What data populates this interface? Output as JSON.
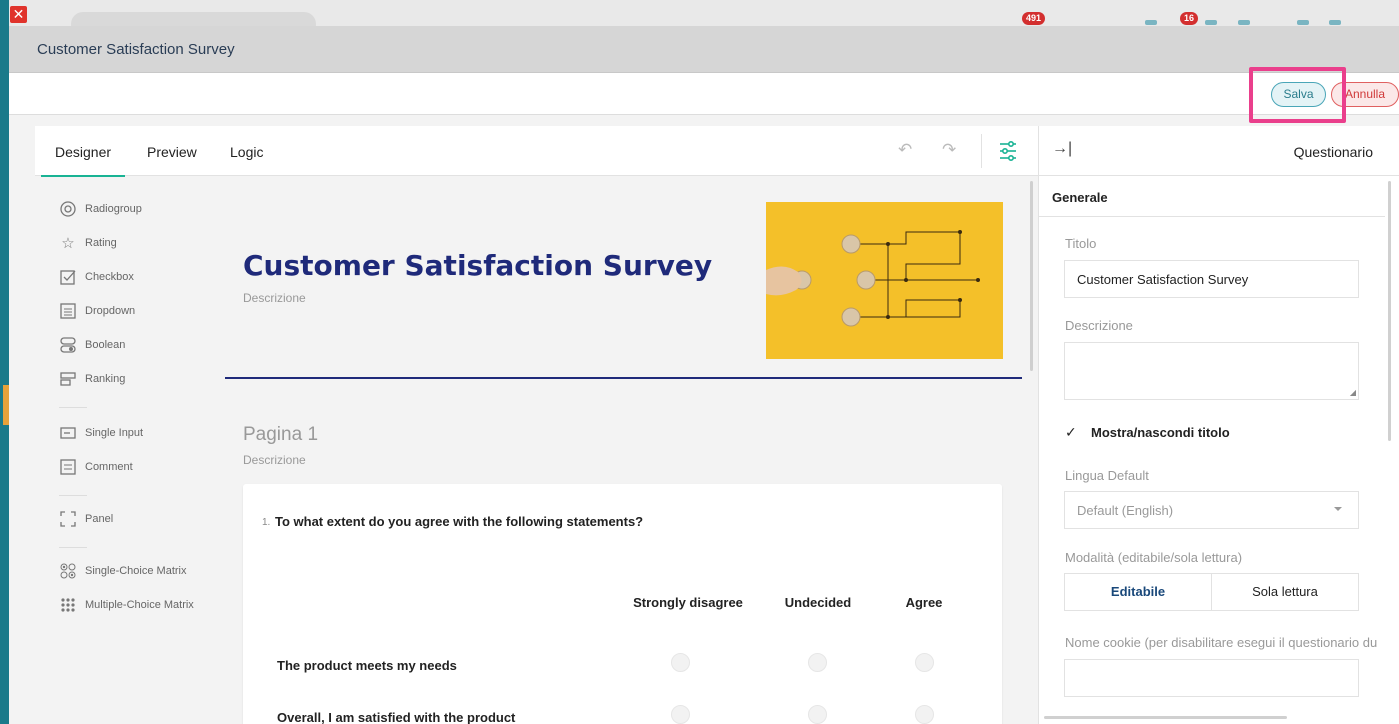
{
  "app": {
    "close_label": "✕",
    "badges": [
      "491",
      "16"
    ],
    "modal_title": "Customer Satisfaction Survey"
  },
  "actions": {
    "save": "Salva",
    "cancel": "Annulla"
  },
  "tabs": {
    "designer": "Designer",
    "preview": "Preview",
    "logic": "Logic",
    "undo_icon": "↶",
    "redo_icon": "↷"
  },
  "toolbox": {
    "items": [
      {
        "label": "Radiogroup",
        "icon": "radiogroup-icon"
      },
      {
        "label": "Rating",
        "icon": "star-icon"
      },
      {
        "label": "Checkbox",
        "icon": "checkbox-icon"
      },
      {
        "label": "Dropdown",
        "icon": "dropdown-icon"
      },
      {
        "label": "Boolean",
        "icon": "boolean-icon"
      },
      {
        "label": "Ranking",
        "icon": "ranking-icon"
      },
      {
        "label": "Single Input",
        "icon": "single-input-icon"
      },
      {
        "label": "Comment",
        "icon": "comment-icon"
      },
      {
        "label": "Panel",
        "icon": "panel-icon"
      },
      {
        "label": "Single-Choice Matrix",
        "icon": "single-matrix-icon"
      },
      {
        "label": "Multiple-Choice Matrix",
        "icon": "multi-matrix-icon"
      }
    ]
  },
  "survey": {
    "title": "Customer Satisfaction Survey",
    "description": "Descrizione",
    "page_title": "Pagina 1",
    "page_description": "Descrizione",
    "question": {
      "number": "1.",
      "text": "To what extent do you agree with the following statements?",
      "columns": [
        "Strongly disagree",
        "Undecided",
        "Agree"
      ],
      "rows": [
        "The product meets my needs",
        "Overall, I am satisfied with the product"
      ]
    }
  },
  "panel": {
    "title": "Questionario",
    "collapse_icon": "→|",
    "section": "Generale",
    "title_label": "Titolo",
    "title_value": "Customer Satisfaction Survey",
    "description_label": "Descrizione",
    "show_title_label": "Mostra/nascondi titolo",
    "language_label": "Lingua Default",
    "language_value": "Default (English)",
    "mode_label": "Modalità (editabile/sola lettura)",
    "mode_editable": "Editabile",
    "mode_readonly": "Sola lettura",
    "cookie_label": "Nome cookie (per disabilitare esegui il questionario du"
  },
  "colors": {
    "accent": "#19b394",
    "title_blue": "#1f2a7a",
    "highlight": "#ea3f8c"
  }
}
